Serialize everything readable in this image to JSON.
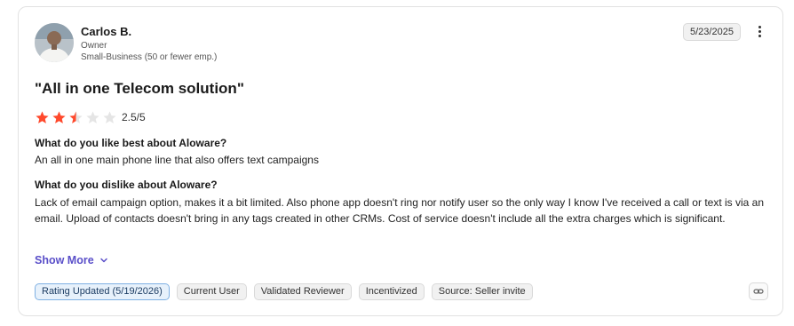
{
  "reviewer": {
    "name": "Carlos B.",
    "role": "Owner",
    "segment": "Small-Business (50 or fewer emp.)"
  },
  "date": "5/23/2025",
  "review": {
    "title": "\"All in one Telecom solution\"",
    "rating_value": 2.5,
    "rating_max": 5,
    "rating_text": "2.5/5",
    "star_color": "#ff492c",
    "star_empty_color": "#e5e5e5",
    "q1": "What do you like best about Aloware?",
    "a1": "An all in one main phone line that also offers text campaigns",
    "q2": "What do you dislike about Aloware?",
    "a2": "Lack of email campaign option, makes it a bit limited. Also phone app doesn't ring nor notify user so the only way I know I've received a call or text is via an email. Upload of contacts doesn't bring in any tags created in other CRMs. Cost of service doesn't include all the extra charges which is significant."
  },
  "show_more_label": "Show More",
  "tags": [
    "Rating Updated (5/19/2026)",
    "Current User",
    "Validated Reviewer",
    "Incentivized",
    "Source: Seller invite"
  ],
  "accent_color": "#5a4fc9"
}
